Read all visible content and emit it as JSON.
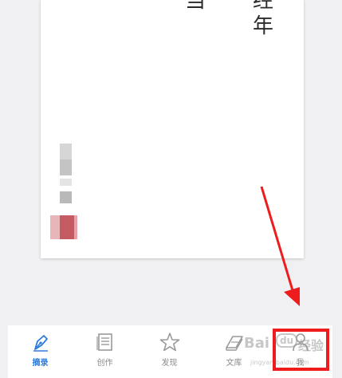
{
  "paper": {
    "chars": [
      "当",
      "经",
      "年"
    ]
  },
  "tabbar": {
    "tabs": [
      {
        "label": "摘录",
        "icon": "pen-nib-icon",
        "active": true
      },
      {
        "label": "创作",
        "icon": "document-icon",
        "active": false
      },
      {
        "label": "发现",
        "icon": "star-icon",
        "active": false
      },
      {
        "label": "文库",
        "icon": "books-icon",
        "active": false
      },
      {
        "label": "我",
        "icon": "person-icon",
        "active": false
      }
    ]
  },
  "watermark": {
    "brand": "Bai",
    "badge": "du",
    "suffix": "经验",
    "sub": "jingyan.baidu.com"
  },
  "colors": {
    "accent": "#2f7bdc",
    "annotation": "#ee1c1c",
    "inactive": "#8a8a8a"
  }
}
